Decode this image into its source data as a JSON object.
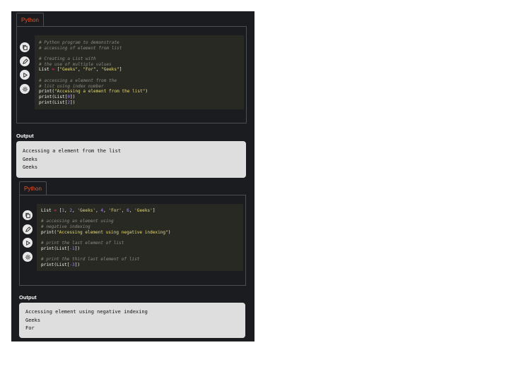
{
  "blocks": [
    {
      "tab": "Python",
      "icons": [
        "copy-icon",
        "edit-icon",
        "run-icon",
        "theme-icon"
      ],
      "code": [
        [
          {
            "t": "# Python program to demonstrate",
            "c": "cmt"
          }
        ],
        [
          {
            "t": "# accessing of element from list",
            "c": "cmt"
          }
        ],
        [
          {
            "t": "",
            "c": "plain"
          }
        ],
        [
          {
            "t": "# Creating a List with",
            "c": "cmt"
          }
        ],
        [
          {
            "t": "# the use of multiple values",
            "c": "cmt"
          }
        ],
        [
          {
            "t": "List ",
            "c": "plain"
          },
          {
            "t": "=",
            "c": "op"
          },
          {
            "t": " [",
            "c": "plain"
          },
          {
            "t": "\"Geeks\"",
            "c": "str"
          },
          {
            "t": ", ",
            "c": "plain"
          },
          {
            "t": "\"For\"",
            "c": "str"
          },
          {
            "t": ", ",
            "c": "plain"
          },
          {
            "t": "\"Geeks\"",
            "c": "str"
          },
          {
            "t": "]",
            "c": "plain"
          }
        ],
        [
          {
            "t": "",
            "c": "plain"
          }
        ],
        [
          {
            "t": "# accessing a element from the",
            "c": "cmt"
          }
        ],
        [
          {
            "t": "# list using index number",
            "c": "cmt"
          }
        ],
        [
          {
            "t": "print(",
            "c": "plain"
          },
          {
            "t": "\"Accessing a element from the list\"",
            "c": "str"
          },
          {
            "t": ")",
            "c": "plain"
          }
        ],
        [
          {
            "t": "print(List[",
            "c": "plain"
          },
          {
            "t": "0",
            "c": "num"
          },
          {
            "t": "])",
            "c": "plain"
          }
        ],
        [
          {
            "t": "print(List[",
            "c": "plain"
          },
          {
            "t": "2",
            "c": "num"
          },
          {
            "t": "])",
            "c": "plain"
          }
        ]
      ],
      "output_label": "Output",
      "output": [
        "Accessing a element from the list",
        "Geeks",
        "Geeks"
      ]
    },
    {
      "tab": "Python",
      "icons": [
        "copy-icon",
        "edit-icon",
        "run-icon",
        "theme-icon"
      ],
      "code": [
        [
          {
            "t": "List ",
            "c": "plain"
          },
          {
            "t": "=",
            "c": "op"
          },
          {
            "t": " [",
            "c": "plain"
          },
          {
            "t": "1",
            "c": "num"
          },
          {
            "t": ", ",
            "c": "plain"
          },
          {
            "t": "2",
            "c": "num"
          },
          {
            "t": ", ",
            "c": "plain"
          },
          {
            "t": "'Geeks'",
            "c": "str"
          },
          {
            "t": ", ",
            "c": "plain"
          },
          {
            "t": "4",
            "c": "num"
          },
          {
            "t": ", ",
            "c": "plain"
          },
          {
            "t": "'For'",
            "c": "str"
          },
          {
            "t": ", ",
            "c": "plain"
          },
          {
            "t": "6",
            "c": "num"
          },
          {
            "t": ", ",
            "c": "plain"
          },
          {
            "t": "'Geeks'",
            "c": "str"
          },
          {
            "t": "]",
            "c": "plain"
          }
        ],
        [
          {
            "t": "",
            "c": "plain"
          }
        ],
        [
          {
            "t": "# accessing an element using",
            "c": "cmt"
          }
        ],
        [
          {
            "t": "# negative indexing",
            "c": "cmt"
          }
        ],
        [
          {
            "t": "print(",
            "c": "plain"
          },
          {
            "t": "\"Accessing element using negative indexing\"",
            "c": "str"
          },
          {
            "t": ")",
            "c": "plain"
          }
        ],
        [
          {
            "t": "",
            "c": "plain"
          }
        ],
        [
          {
            "t": "# print the last element of list",
            "c": "cmt"
          }
        ],
        [
          {
            "t": "print(List[",
            "c": "plain"
          },
          {
            "t": "-1",
            "c": "num"
          },
          {
            "t": "])",
            "c": "plain"
          }
        ],
        [
          {
            "t": "",
            "c": "plain"
          }
        ],
        [
          {
            "t": "# print the third last element of list",
            "c": "cmt"
          }
        ],
        [
          {
            "t": "print(List[",
            "c": "plain"
          },
          {
            "t": "-3",
            "c": "num"
          },
          {
            "t": "])",
            "c": "plain"
          }
        ]
      ],
      "output_label": "Output",
      "output": [
        "Accessing element using negative indexing",
        "Geeks",
        "For"
      ]
    }
  ],
  "colors": {
    "page_bg": "#1b1c1f",
    "tab_text": "#e0582f",
    "code_bg": "#282923",
    "output_bg": "#dedede"
  }
}
